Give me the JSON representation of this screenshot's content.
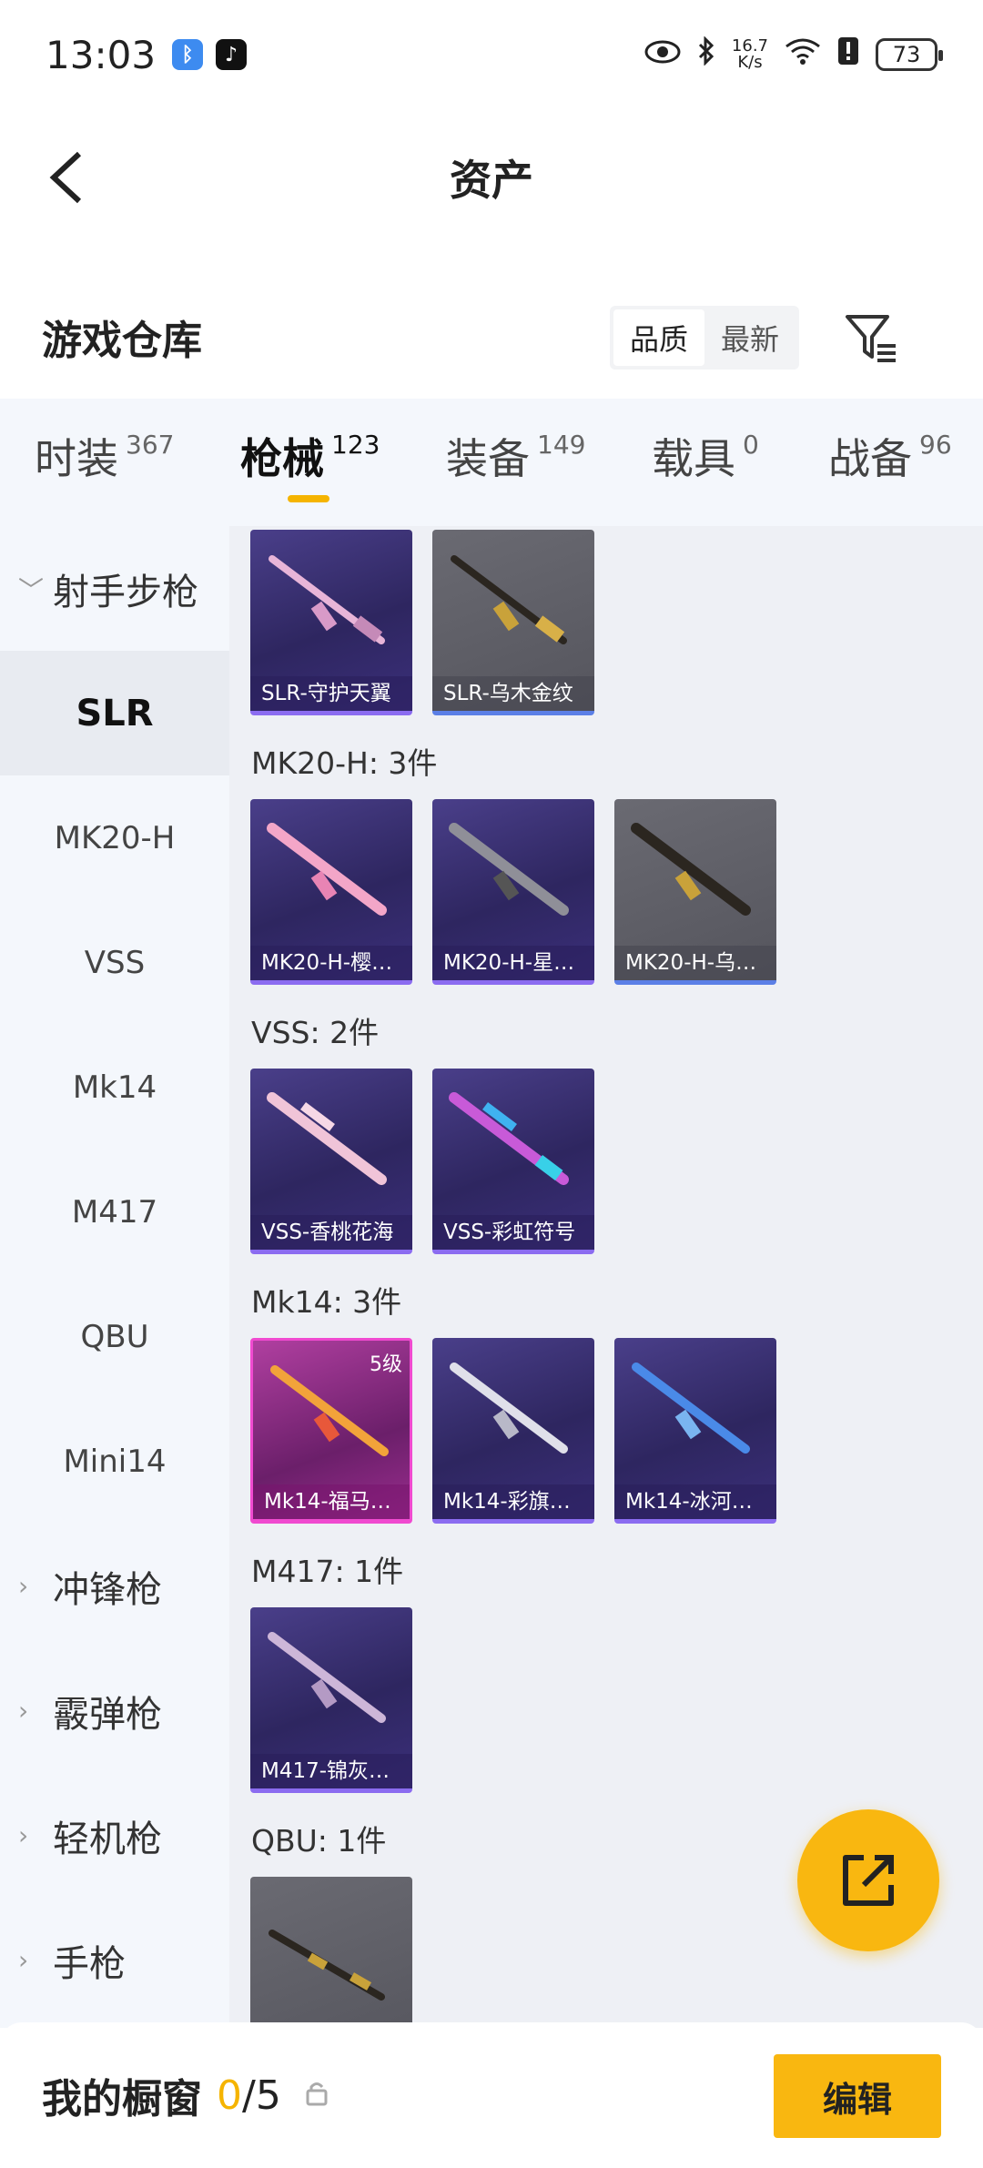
{
  "status_bar": {
    "time": "13:03",
    "speed_top": "16.7",
    "speed_bottom": "K/s",
    "battery": "73"
  },
  "header": {
    "title": "资产"
  },
  "warehouse": {
    "title": "游戏仓库",
    "sort_quality": "品质",
    "sort_latest": "最新"
  },
  "tabs": [
    {
      "label": "时装",
      "count": "367"
    },
    {
      "label": "枪械",
      "count": "123"
    },
    {
      "label": "装备",
      "count": "149"
    },
    {
      "label": "载具",
      "count": "0"
    },
    {
      "label": "战备",
      "count": "96"
    }
  ],
  "sidebar": {
    "category_open": "射手步枪",
    "subitems": [
      "SLR",
      "MK20-H",
      "VSS",
      "Mk14",
      "M417",
      "QBU",
      "Mini14"
    ],
    "categories": [
      "冲锋枪",
      "霰弹枪",
      "轻机枪",
      "手枪"
    ]
  },
  "content": {
    "groups": [
      {
        "label": "",
        "items": [
          {
            "name": "SLR-守护天翼"
          },
          {
            "name": "SLR-乌木金纹"
          }
        ]
      },
      {
        "label": "MK20-H: 3件",
        "items": [
          {
            "name": "MK20-H-樱…"
          },
          {
            "name": "MK20-H-星…"
          },
          {
            "name": "MK20-H-乌…"
          }
        ]
      },
      {
        "label": "VSS: 2件",
        "items": [
          {
            "name": "VSS-香桃花海"
          },
          {
            "name": "VSS-彩虹符号"
          }
        ]
      },
      {
        "label": "Mk14: 3件",
        "items": [
          {
            "name": "Mk14-福马…",
            "level": "5级"
          },
          {
            "name": "Mk14-彩旗…"
          },
          {
            "name": "Mk14-冰河…"
          }
        ]
      },
      {
        "label": "M417: 1件",
        "items": [
          {
            "name": "M417-锦灰…"
          }
        ]
      },
      {
        "label": "QBU: 1件",
        "items": [
          {
            "name": ""
          }
        ]
      }
    ]
  },
  "bottom": {
    "title": "我的橱窗",
    "count": "0",
    "sep": "/",
    "total": "5",
    "edit_label": "编辑"
  },
  "colors": {
    "accent": "#f9b710",
    "sidebar_bg": "#f4f7fc",
    "content_bg": "#eef0f5"
  }
}
